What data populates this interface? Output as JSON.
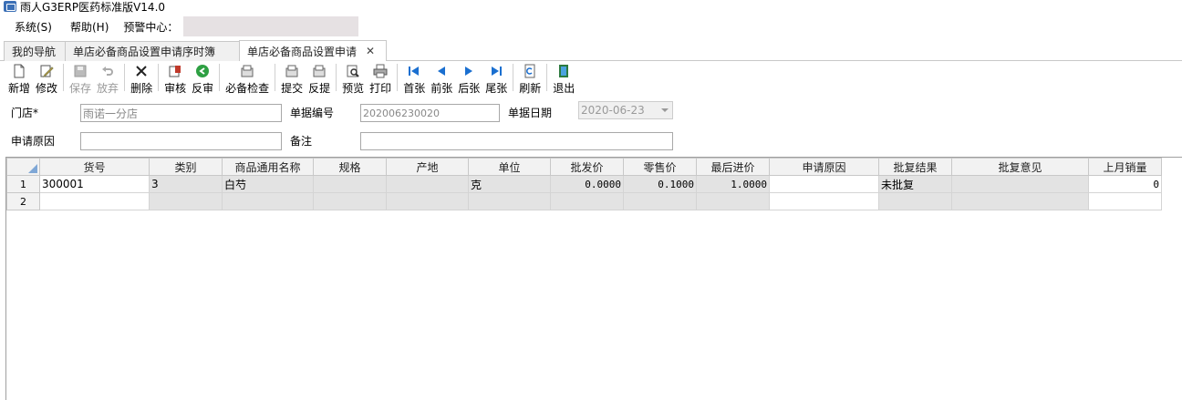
{
  "app": {
    "title": "雨人G3ERP医药标准版V14.0"
  },
  "menu": {
    "system": "系统(S)",
    "help": "帮助(H)",
    "alert_center": "预警中心："
  },
  "tabs": [
    {
      "label": "我的导航"
    },
    {
      "label": "单店必备商品设置申请序时簿"
    },
    {
      "label": "单店必备商品设置申请",
      "close": "✕"
    }
  ],
  "toolbar": [
    {
      "label": "新增",
      "icon": "new-doc-icon"
    },
    {
      "label": "修改",
      "icon": "edit-icon"
    },
    {
      "label": "保存",
      "icon": "save-icon",
      "disabled": true
    },
    {
      "label": "放弃",
      "icon": "undo-icon",
      "disabled": true
    },
    {
      "label": "删除",
      "icon": "delete-icon"
    },
    {
      "label": "审核",
      "icon": "approve-icon"
    },
    {
      "label": "反审",
      "icon": "unapprove-icon"
    },
    {
      "label": "必备检查",
      "icon": "check-icon"
    },
    {
      "label": "提交",
      "icon": "submit-icon"
    },
    {
      "label": "反提",
      "icon": "unsubmit-icon"
    },
    {
      "label": "预览",
      "icon": "preview-icon"
    },
    {
      "label": "打印",
      "icon": "print-icon"
    },
    {
      "label": "首张",
      "icon": "first-icon"
    },
    {
      "label": "前张",
      "icon": "prev-icon"
    },
    {
      "label": "后张",
      "icon": "next-icon"
    },
    {
      "label": "尾张",
      "icon": "last-icon"
    },
    {
      "label": "刷新",
      "icon": "refresh-icon"
    },
    {
      "label": "退出",
      "icon": "exit-icon"
    }
  ],
  "form": {
    "store_label": "门店*",
    "store_value": "雨诺一分店",
    "doc_no_label": "单据编号",
    "doc_no_value": "202006230020",
    "doc_date_label": "单据日期",
    "doc_date_value": "2020-06-23",
    "reason_label": "申请原因",
    "reason_value": "",
    "remark_label": "备注",
    "remark_value": ""
  },
  "grid": {
    "columns": [
      "货号",
      "类别",
      "商品通用名称",
      "规格",
      "产地",
      "单位",
      "批发价",
      "零售价",
      "最后进价",
      "申请原因",
      "批复结果",
      "批复意见",
      "上月销量"
    ],
    "rows": [
      {
        "n": "1",
        "cells": [
          "300001",
          "3",
          "白芍",
          "",
          "",
          "克",
          "0.0000",
          "0.1000",
          "1.0000",
          "",
          "未批复",
          "",
          "0"
        ]
      },
      {
        "n": "2",
        "cells": [
          "",
          "",
          "",
          "",
          "",
          "",
          "",
          "",
          "",
          "",
          "",
          "",
          ""
        ]
      }
    ]
  },
  "colors": {
    "accent": "#1a6fd0",
    "grid_gray": "#e3e3e3",
    "header_bg": "#f2f2f2"
  }
}
